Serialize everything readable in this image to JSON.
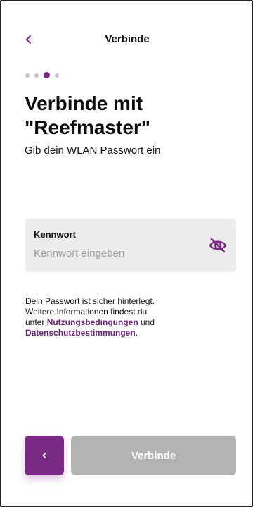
{
  "header": {
    "title": "Verbinde",
    "back_icon": "chevron-left-icon"
  },
  "progress": {
    "total_steps": 4,
    "current_step": 3
  },
  "content": {
    "headline_line1": "Verbinde mit",
    "headline_line2": "\"Reefmaster\"",
    "subline": "Gib dein WLAN Passwort ein"
  },
  "password_field": {
    "label": "Kennwort",
    "placeholder": "Kennwort eingeben",
    "value": "",
    "visibility_icon": "eye-off-icon"
  },
  "info": {
    "text_line1": "Dein Passwort ist sicher hinterlegt.",
    "text_line2": "Weitere Informationen findest du",
    "text_line3_prefix": "unter ",
    "terms_link": "Nutzungsbedingungen",
    "text_and": " und",
    "privacy_link": "Datenschutzbestimmungen",
    "text_end": "."
  },
  "footer": {
    "back_button_label": "<",
    "primary_button_label": "Verbinde"
  },
  "colors": {
    "accent": "#7a2b84",
    "disabled": "#b3b3b3",
    "field_bg": "#ececec"
  }
}
